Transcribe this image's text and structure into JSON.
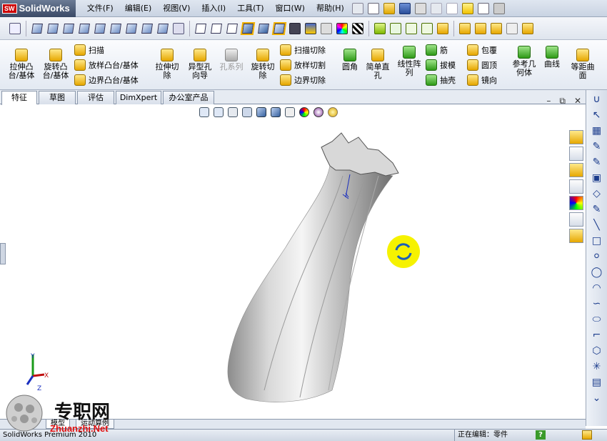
{
  "app": {
    "logo_badge": "SW",
    "logo_text": "SolidWorks"
  },
  "menu": [
    "文件(F)",
    "编辑(E)",
    "视图(V)",
    "插入(I)",
    "工具(T)",
    "窗口(W)",
    "帮助(H)"
  ],
  "commands": {
    "extrude_boss": "拉伸凸\n台/基体",
    "revolve_boss": "旋转凸\n台/基体",
    "sweep": "扫描",
    "loft_boss": "放样凸台/基体",
    "boundary_boss": "边界凸台/基体",
    "extrude_cut": "拉伸切\n除",
    "hole_wizard": "异型孔\n向导",
    "hole_series": "孔系列",
    "revolve_cut": "旋转切\n除",
    "sweep_cut": "扫描切除",
    "loft_cut": "放样切割",
    "boundary_cut": "边界切除",
    "fillet": "圆角",
    "simple_hole": "简单直\n孔",
    "linear_pattern": "线性阵\n列",
    "rib": "筋",
    "draft": "拔模",
    "shell": "抽壳",
    "wrap": "包覆",
    "dome": "圆顶",
    "mirror": "镜向",
    "ref_geometry": "参考几\n何体",
    "curves": "曲线",
    "offset_surface": "等距曲\n面"
  },
  "tabs": [
    "特征",
    "草图",
    "评估",
    "DimXpert",
    "办公室产品"
  ],
  "window_controls": {
    "restore": "⧉",
    "close": "✕"
  },
  "bottom_tabs": [
    "模型",
    "运动算例"
  ],
  "status": {
    "product": "SolidWorks Premium 2010",
    "editing": "正在编辑：零件",
    "help": "?"
  },
  "watermark": {
    "cn": "专职网",
    "url": "Zhuanzhi.Net"
  },
  "triad_labels": {
    "y": "Y",
    "x": "X",
    "z": "Z"
  }
}
